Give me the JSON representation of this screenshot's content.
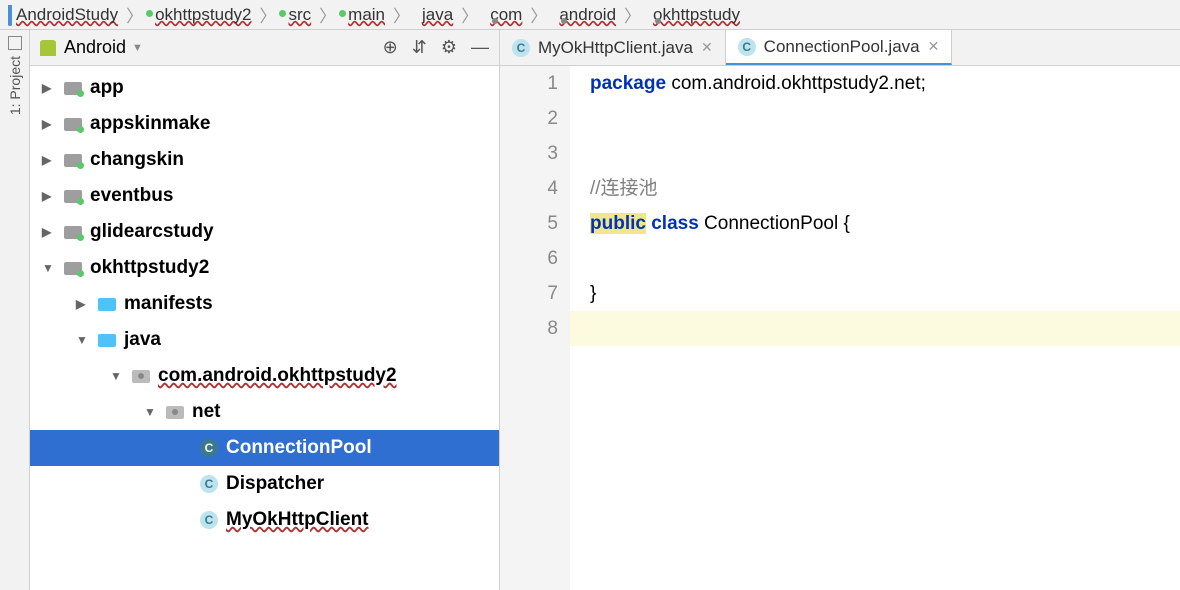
{
  "breadcrumb": [
    {
      "icon": "coffee",
      "label": "AndroidStudy",
      "wavy": true
    },
    {
      "icon": "folder",
      "label": "okhttpstudy2",
      "wavy": true
    },
    {
      "icon": "folder-g",
      "label": "src",
      "wavy": true
    },
    {
      "icon": "folder-g",
      "label": "main",
      "wavy": true
    },
    {
      "icon": "bluefolder",
      "label": "java",
      "wavy": true
    },
    {
      "icon": "pkg",
      "label": "com",
      "wavy": true
    },
    {
      "icon": "pkg",
      "label": "android",
      "wavy": true
    },
    {
      "icon": "pkg",
      "label": "okhttpstudy",
      "wavy": true
    }
  ],
  "side_tab": {
    "label": "1: Project"
  },
  "panel": {
    "title": "Android"
  },
  "tree": [
    {
      "depth": 0,
      "arrow": "▶",
      "icon": "folder",
      "label": "app",
      "wavy": false
    },
    {
      "depth": 0,
      "arrow": "▶",
      "icon": "folder",
      "label": "appskinmake",
      "wavy": false
    },
    {
      "depth": 0,
      "arrow": "▶",
      "icon": "folder",
      "label": "changskin",
      "wavy": false
    },
    {
      "depth": 0,
      "arrow": "▶",
      "icon": "folder",
      "label": "eventbus",
      "wavy": false
    },
    {
      "depth": 0,
      "arrow": "▶",
      "icon": "folder",
      "label": "glidearcstudy",
      "wavy": false
    },
    {
      "depth": 0,
      "arrow": "▼",
      "icon": "folder",
      "label": "okhttpstudy2",
      "wavy": false
    },
    {
      "depth": 1,
      "arrow": "▶",
      "icon": "bluefolder",
      "label": "manifests",
      "wavy": false
    },
    {
      "depth": 1,
      "arrow": "▼",
      "icon": "bluefolder",
      "label": "java",
      "wavy": false
    },
    {
      "depth": 2,
      "arrow": "▼",
      "icon": "pkg",
      "label": "com.android.okhttpstudy2",
      "wavy": true
    },
    {
      "depth": 3,
      "arrow": "▼",
      "icon": "pkg",
      "label": "net",
      "wavy": false
    },
    {
      "depth": 4,
      "arrow": "",
      "icon": "class",
      "label": "ConnectionPool",
      "wavy": false,
      "selected": true
    },
    {
      "depth": 4,
      "arrow": "",
      "icon": "class",
      "label": "Dispatcher",
      "wavy": false
    },
    {
      "depth": 4,
      "arrow": "",
      "icon": "class",
      "label": "MyOkHttpClient",
      "wavy": true
    }
  ],
  "tabs": [
    {
      "icon": "class",
      "label": "MyOkHttpClient.java",
      "active": false
    },
    {
      "icon": "class",
      "label": "ConnectionPool.java",
      "active": true
    }
  ],
  "code": {
    "lines": [
      {
        "n": 1,
        "frag": [
          {
            "t": "package ",
            "cls": "kw"
          },
          {
            "t": "com.android.okhttpstudy2.net;",
            "cls": ""
          }
        ]
      },
      {
        "n": 2,
        "frag": []
      },
      {
        "n": 3,
        "frag": []
      },
      {
        "n": 4,
        "frag": [
          {
            "t": "//连接池",
            "cls": "cmt"
          }
        ]
      },
      {
        "n": 5,
        "frag": [
          {
            "t": "public",
            "cls": "kw hl-kw"
          },
          {
            "t": " ",
            "cls": ""
          },
          {
            "t": "class",
            "cls": "kw"
          },
          {
            "t": " ConnectionPool {",
            "cls": ""
          }
        ]
      },
      {
        "n": 6,
        "frag": []
      },
      {
        "n": 7,
        "frag": [
          {
            "t": "}",
            "cls": ""
          }
        ]
      },
      {
        "n": 8,
        "frag": [],
        "cursor": true
      }
    ]
  }
}
